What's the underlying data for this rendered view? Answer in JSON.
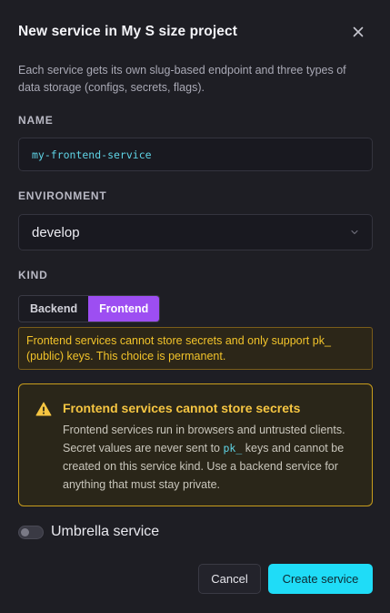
{
  "dialog": {
    "title": "New service in My S size project",
    "description": "Each service gets its own slug-based endpoint and three types of data storage (configs, secrets, flags)."
  },
  "name_field": {
    "label": "NAME",
    "value": "my-frontend-service"
  },
  "environment_field": {
    "label": "ENVIRONMENT",
    "value": "develop"
  },
  "kind_field": {
    "label": "KIND",
    "options": [
      "Backend",
      "Frontend"
    ],
    "selected": "Frontend",
    "note": "Frontend services cannot store secrets and only support pk_ (public) keys. This choice is permanent."
  },
  "warning": {
    "title": "Frontend services cannot store secrets",
    "body_part1": "Frontend services run in browsers and untrusted clients. Secret values are never sent to ",
    "body_code": "pk_",
    "body_part2": " keys and cannot be created on this service kind. Use a backend service for anything that must stay private."
  },
  "umbrella": {
    "label": "Umbrella service",
    "enabled": false
  },
  "actions": {
    "cancel_label": "Cancel",
    "create_label": "Create service"
  },
  "colors": {
    "accent": "#1fdcf7",
    "kind_active": "#9d4ef2",
    "warning": "#f5c542"
  }
}
